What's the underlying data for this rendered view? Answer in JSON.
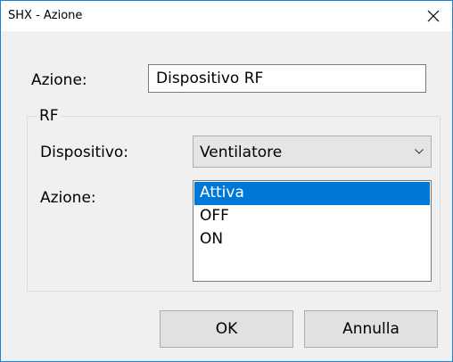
{
  "window": {
    "title": "SHX - Azione",
    "accent_color": "#1883d7"
  },
  "form": {
    "action_label": "Azione:",
    "action_value": "Dispositivo RF"
  },
  "rf_group": {
    "legend": "RF",
    "device_label": "Dispositivo:",
    "device_selected": "Ventilatore",
    "action_label": "Azione:",
    "action_options": [
      {
        "label": "Attiva",
        "selected": true
      },
      {
        "label": "OFF",
        "selected": false
      },
      {
        "label": "ON",
        "selected": false
      }
    ],
    "selection_color": "#0078d7"
  },
  "buttons": {
    "ok_label": "OK",
    "cancel_label": "Annulla"
  }
}
